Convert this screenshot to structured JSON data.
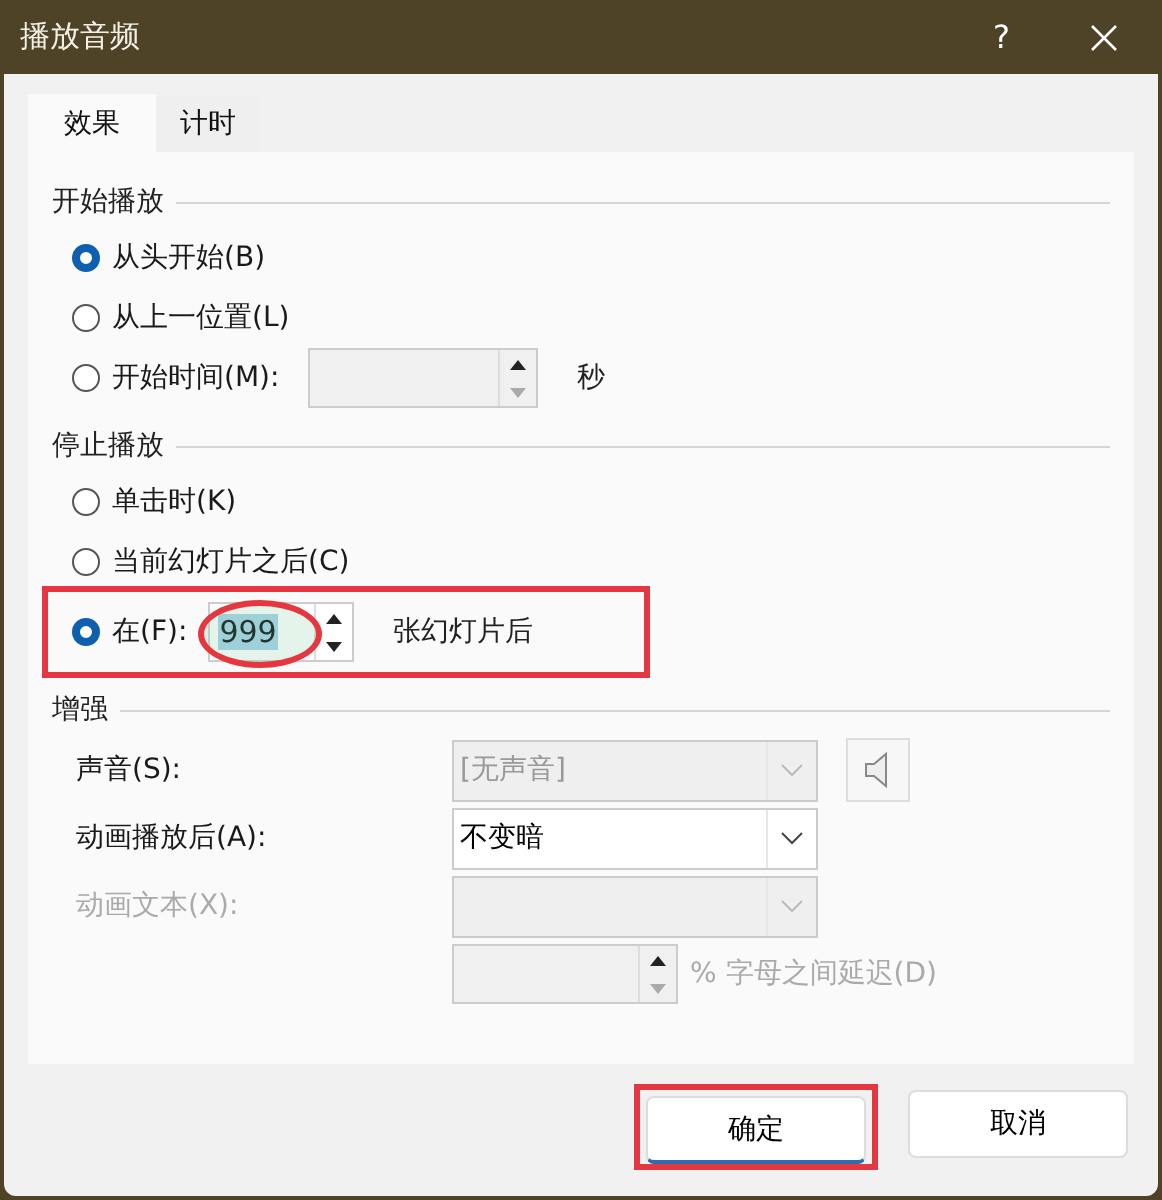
{
  "window": {
    "title": "播放音频",
    "help": "?"
  },
  "tabs": [
    {
      "label": "效果",
      "selected": true
    },
    {
      "label": "计时",
      "selected": false
    }
  ],
  "start_playback": {
    "title": "开始播放",
    "options": [
      {
        "label": "从头开始(B)",
        "selected": true
      },
      {
        "label": "从上一位置(L)",
        "selected": false
      },
      {
        "label": "开始时间(M):",
        "selected": false,
        "kind": "time",
        "unit": "秒",
        "disabled": true
      }
    ]
  },
  "stop_playback": {
    "title": "停止播放",
    "options": [
      {
        "label": "单击时(K)",
        "selected": false,
        "highlighted": false
      },
      {
        "label": "当前幻灯片之后(C)",
        "selected": false,
        "highlighted": false
      },
      {
        "label": "在(F):",
        "selected": true,
        "kind": "count",
        "value": "999",
        "suffix": "张幻灯片后",
        "highlighted": true,
        "circled": true
      }
    ]
  },
  "enhancements": {
    "title": "增强",
    "rows": [
      {
        "label": "声音(S):",
        "label_disabled": false,
        "kind": "dropdown",
        "value": "[无声音]",
        "disabled": true,
        "speaker": true
      },
      {
        "label": "动画播放后(A):",
        "label_disabled": false,
        "kind": "dropdown",
        "value": "不变暗",
        "disabled": false
      },
      {
        "label": "动画文本(X):",
        "label_disabled": true,
        "kind": "dropdown",
        "disabled": true
      },
      {
        "kind": "spinner",
        "suffix": "% 字母之间延迟(D)",
        "disabled": true
      }
    ]
  },
  "buttons": [
    {
      "label": "确定",
      "highlighted": true
    },
    {
      "label": "取消",
      "highlighted": false
    }
  ]
}
